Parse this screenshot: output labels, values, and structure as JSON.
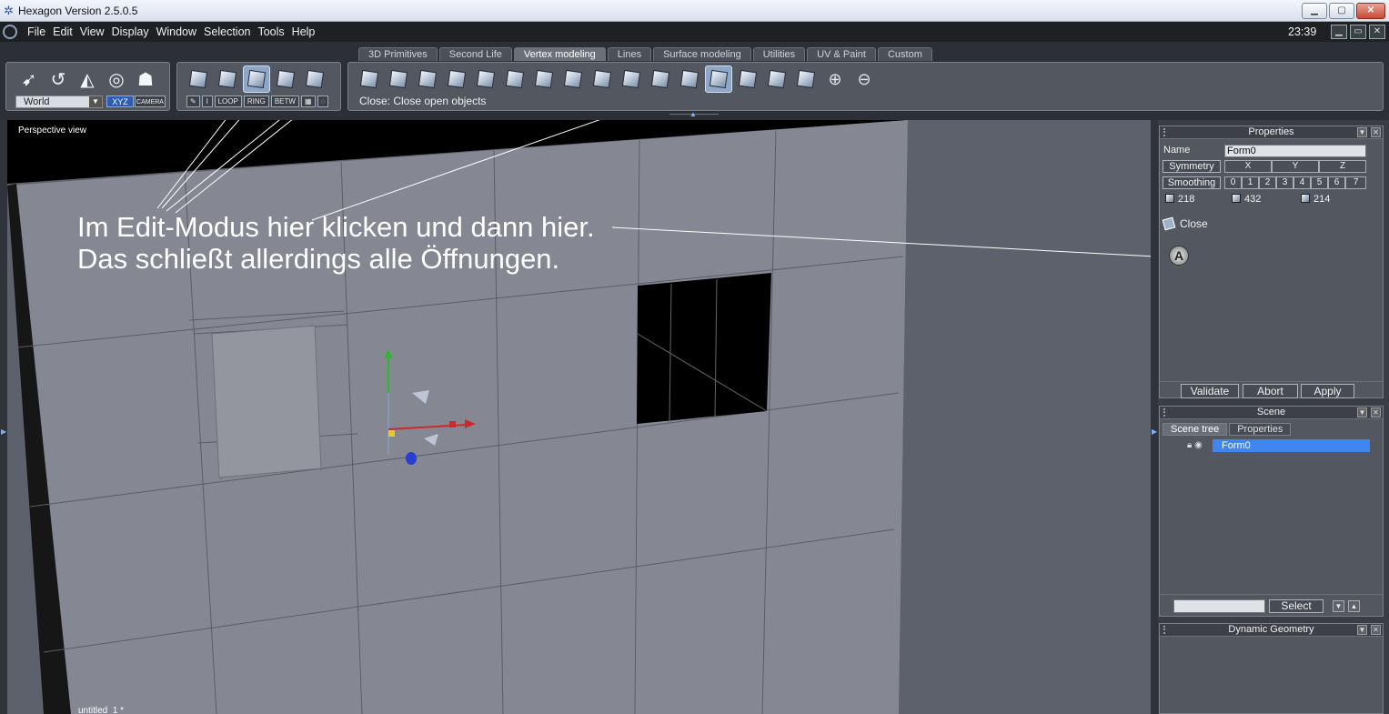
{
  "window": {
    "title": "Hexagon Version 2.5.0.5"
  },
  "menu": {
    "items": [
      "File",
      "Edit",
      "View",
      "Display",
      "Window",
      "Selection",
      "Tools",
      "Help"
    ],
    "clock": "23:39"
  },
  "tabs": [
    "3D Primitives",
    "Second Life",
    "Vertex modeling",
    "Lines",
    "Surface modeling",
    "Utilities",
    "UV & Paint",
    "Custom"
  ],
  "active_tab": "Vertex modeling",
  "nav": {
    "space": "World",
    "xyz": "XYZ",
    "camera": "CAMERA"
  },
  "selection_modes": [
    "LOOP",
    "RING",
    "BETW"
  ],
  "status": "Close: Close open objects",
  "viewport": {
    "label": "Perspective view",
    "doc_name": "untitled_1 *",
    "annotation_line1": "Im Edit-Modus hier klicken und dann hier.",
    "annotation_line2": "Das schließt allerdings alle Öffnungen."
  },
  "properties": {
    "title": "Properties",
    "name_label": "Name",
    "name_value": "Form0",
    "symmetry_label": "Symmetry",
    "symmetry_axes": [
      "X",
      "Y",
      "Z"
    ],
    "smoothing_label": "Smoothing",
    "smoothing_levels": [
      "0",
      "1",
      "2",
      "3",
      "4",
      "5",
      "6",
      "7"
    ],
    "counts": [
      "218",
      "432",
      "214"
    ],
    "tool_name": "Close",
    "validate": "Validate",
    "abort": "Abort",
    "apply": "Apply"
  },
  "scene": {
    "title": "Scene",
    "tabs": [
      "Scene tree",
      "Properties"
    ],
    "item": "Form0",
    "select": "Select"
  },
  "dynamic_geometry": {
    "title": "Dynamic Geometry"
  },
  "colors": {
    "accent": "#3f86f0",
    "viewport": "#5c616b",
    "mesh_face": "#858893",
    "hole": "#000000"
  }
}
